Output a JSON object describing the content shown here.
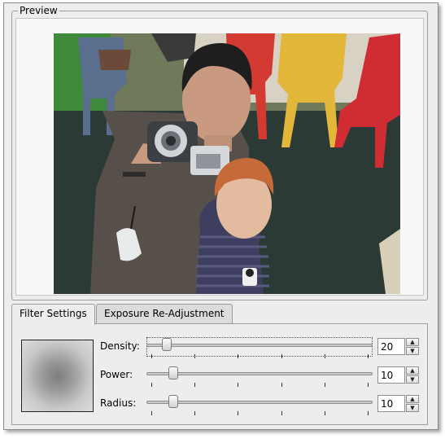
{
  "preview": {
    "title": "Preview"
  },
  "tabs": [
    {
      "label": "Filter Settings",
      "active": true
    },
    {
      "label": "Exposure Re-Adjustment",
      "active": false
    }
  ],
  "settings": {
    "density": {
      "label": "Density:",
      "value": "20",
      "slider_fraction": 0.07
    },
    "power": {
      "label": "Power:",
      "value": "10",
      "slider_fraction": 0.1
    },
    "radius": {
      "label": "Radius:",
      "value": "10",
      "slider_fraction": 0.1
    }
  },
  "icons": {
    "spin_up": "chevron-up-icon",
    "spin_down": "chevron-down-icon"
  }
}
